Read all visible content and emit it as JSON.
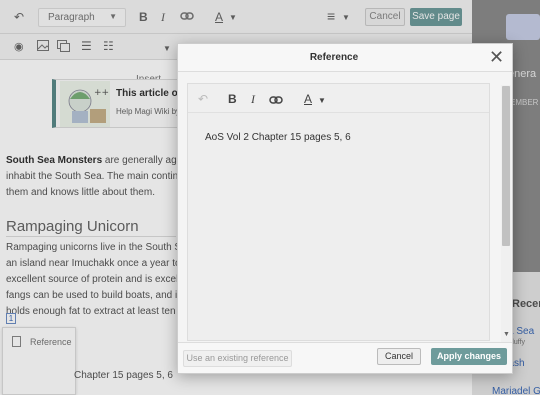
{
  "toolbar": {
    "undo_icon": "undo-icon",
    "paragraph_label": "Paragraph",
    "bold_label": "B",
    "italic_label": "I",
    "text_style_label": "A",
    "cancel_label": "Cancel",
    "save_label": "Save page",
    "insert_label": "Insert"
  },
  "article_notice": {
    "title": "This article or",
    "subtitle": "Help Magi Wiki by"
  },
  "content": {
    "intro_bold": "South Sea Monsters",
    "intro_rest": " are generally aggr",
    "line2": "inhabit the South Sea. The main continen",
    "line3": "them and knows little about them.",
    "heading": "Rampaging Unicorn",
    "p1": "Rampaging unicorns live in the South Se",
    "p2": "an island near Imuchakk once a year to b",
    "p3": "excellent source of protein and is excelle",
    "p4": "fangs can be used to build boats, and its",
    "p5": "holds enough fat to extract at least ten bu",
    "ref_mark": "1",
    "ref_popup_label": "Reference",
    "ref_text": "Chapter 15 pages 5, 6"
  },
  "sidebar": {
    "general": "enera",
    "members": "EMBER",
    "recent": "Recen",
    "item1": "a Sea",
    "item2": "Fluffy",
    "item3": "n-Lash",
    "item4": "Mariadel Gr"
  },
  "modal": {
    "title": "Reference",
    "close_label": "✕",
    "editor": {
      "bold_label": "B",
      "italic_label": "I",
      "text_style_label": "A",
      "content": "AoS Vol 2 Chapter 15 pages 5, 6"
    },
    "use_existing_label": "Use an existing reference",
    "cancel_label": "Cancel",
    "apply_label": "Apply changes"
  },
  "colors": {
    "accent": "#6e9b9b",
    "link": "#3b69b6"
  }
}
